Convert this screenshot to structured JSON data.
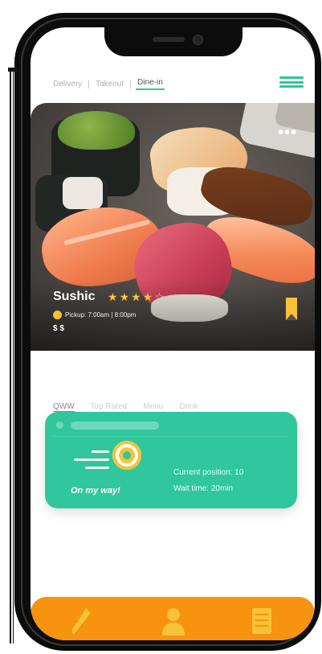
{
  "top_tabs": [
    {
      "label": "Delivery"
    },
    {
      "label": "Takeout"
    },
    {
      "label": "Dine-in"
    }
  ],
  "restaurant": {
    "name": "Sushic",
    "rating": 4,
    "rating_max": 5,
    "pickup": "Pickup: 7:00am | 8:00pm",
    "price_level": "$ $"
  },
  "sub_tabs": [
    {
      "label": "QWW"
    },
    {
      "label": "Top Rated"
    },
    {
      "label": "Menu"
    },
    {
      "label": "Drink"
    }
  ],
  "status_card": {
    "status": "On my way!",
    "position": "Current position: 10",
    "wait": "Wait time: 20min"
  },
  "colors": {
    "accent": "#2fc79b",
    "bottom_bar": "#f7930f",
    "star": "#f7c236"
  },
  "icons": {
    "menu": "hamburger-menu-icon",
    "more": "more-dots-icon",
    "bookmark": "bookmark-icon",
    "target": "target-icon",
    "utensils": "utensils-icon",
    "person": "person-icon",
    "list": "list-icon"
  }
}
